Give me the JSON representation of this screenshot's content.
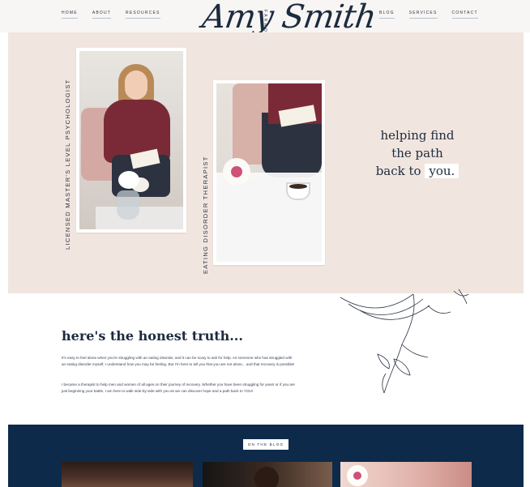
{
  "header": {
    "nav_left": [
      {
        "label": "HOME"
      },
      {
        "label": "ABOUT"
      },
      {
        "label": "RESOURCES"
      }
    ],
    "nav_right": [
      {
        "label": "BLOG"
      },
      {
        "label": "SERVICES"
      },
      {
        "label": "CONTACT"
      }
    ],
    "logo": {
      "name": "Amy Smith",
      "subtitle": "FARROW"
    }
  },
  "hero": {
    "label_left": "LICENSED MASTER'S LEVEL PSYCHOLOGIST",
    "label_middle": "EATING DISORDER THERAPIST",
    "tagline_line1": "helping find",
    "tagline_line2": "the path",
    "tagline_line3_prefix": "back to",
    "tagline_line3_highlight": "you."
  },
  "truth": {
    "title": "here's the honest truth...",
    "paragraph1": "It's easy to feel alone when you're struggling with an eating disorder, and it can be scary to ask for help. As someone who has struggled with an eating disorder myself, I understand how you may be feeling. But I'm here to tell you that you are not alone... and that recovery is possible!",
    "paragraph2": "I became a therapist to help men and women of all ages on their journey of recovery. Whether you have been struggling for years or if you are just beginning your battle, I am here to walk side-by-side with you as we can discover hope and a path back to YOU!"
  },
  "blog": {
    "pill_label": "ON THE BLOG"
  },
  "colors": {
    "navy": "#0e2a4a",
    "blush": "#f1e5df",
    "ink": "#1d2b3f",
    "accent_pink": "#d0507a"
  }
}
